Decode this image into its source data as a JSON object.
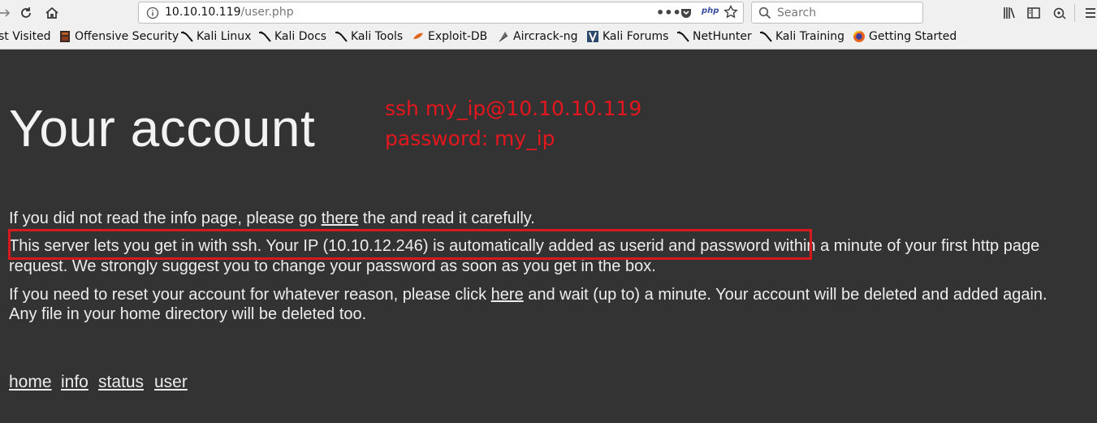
{
  "browser": {
    "url_host": "10.10.10.119",
    "url_path": "/user.php",
    "search_placeholder": "Search",
    "php_badge": "php"
  },
  "bookmarks": [
    {
      "label": "st Visited",
      "icon": "most-visited-icon"
    },
    {
      "label": "Offensive Security",
      "icon": "offsec-icon"
    },
    {
      "label": "Kali Linux",
      "icon": "kali-dragon-icon"
    },
    {
      "label": "Kali Docs",
      "icon": "kali-dragon-icon"
    },
    {
      "label": "Kali Tools",
      "icon": "kali-dragon-icon"
    },
    {
      "label": "Exploit-DB",
      "icon": "exploit-db-icon"
    },
    {
      "label": "Aircrack-ng",
      "icon": "aircrack-icon"
    },
    {
      "label": "Kali Forums",
      "icon": "kali-forums-icon"
    },
    {
      "label": "NetHunter",
      "icon": "kali-dragon-icon"
    },
    {
      "label": "Kali Training",
      "icon": "kali-dragon-icon"
    },
    {
      "label": "Getting Started",
      "icon": "firefox-icon"
    }
  ],
  "page": {
    "title": "Your account",
    "annotation_line1": "ssh my_ip@10.10.10.119",
    "annotation_line2": "password: my_ip",
    "p1_before": "If you did not read the info page, please go ",
    "p1_link": "there",
    "p1_after": " the and read it carefully.",
    "p2_line1": "This server lets you get in with ssh. Your IP (10.10.12.246) is automatically added as userid and password within a minute of your first http page",
    "p2_line2": "request. We strongly suggest you to change your password as soon as you get in the box.",
    "p3_before": "If you need to reset your account for whatever reason, please click ",
    "p3_link": "here",
    "p3_after": " and wait (up to) a minute. Your account will be deleted and added again.",
    "p3_line2": "Any file in your home directory will be deleted too.",
    "footer_links": [
      "home",
      "info",
      "status",
      "user"
    ],
    "colors": {
      "background": "#333333",
      "annotation": "#e3171d",
      "highlight": "#d5191c"
    }
  }
}
